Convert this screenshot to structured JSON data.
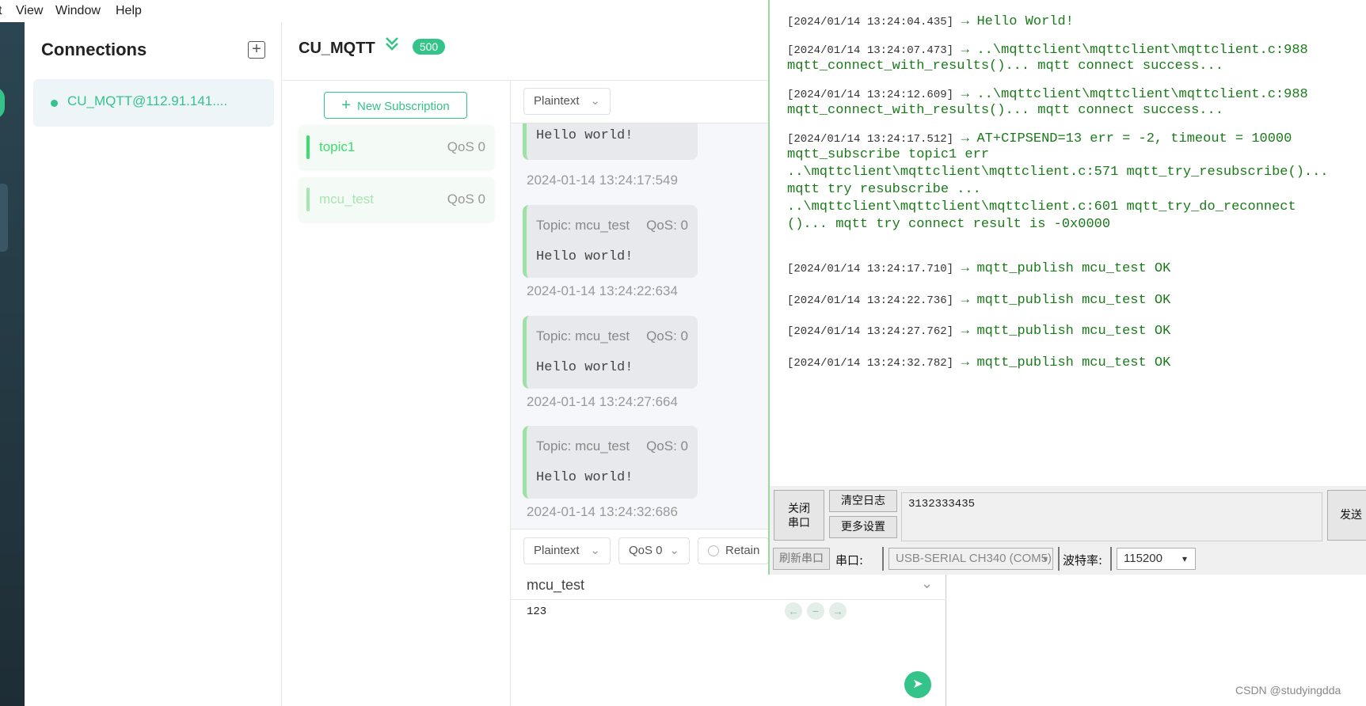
{
  "menubar": {
    "items": [
      "t",
      "View",
      "Window",
      "Help"
    ]
  },
  "connections": {
    "title": "Connections",
    "add_icon": "+",
    "items": [
      {
        "label": "CU_MQTT@112.91.141...."
      }
    ]
  },
  "topic_header": {
    "title": "CU_MQTT",
    "chevron": "⌄",
    "badge": "500"
  },
  "subscriptions": {
    "new_button": "New Subscription",
    "new_icon": "+",
    "items": [
      {
        "name": "topic1",
        "qos": "QoS 0",
        "color": "#3ddc6e"
      },
      {
        "name": "mcu_test",
        "qos": "QoS 0",
        "color": "#a8e6b0"
      }
    ]
  },
  "message_view": {
    "format": "Plaintext",
    "caret": "⌄",
    "messages": [
      {
        "payload": "Hello world!",
        "time": "2024-01-14 13:24:17:549"
      },
      {
        "topic": "Topic: mcu_test",
        "qos": "QoS: 0",
        "payload": "Hello world!",
        "time": "2024-01-14 13:24:22:634"
      },
      {
        "topic": "Topic: mcu_test",
        "qos": "QoS: 0",
        "payload": "Hello world!",
        "time": "2024-01-14 13:24:27:664"
      },
      {
        "topic": "Topic: mcu_test",
        "qos": "QoS: 0",
        "payload": "Hello world!",
        "time": "2024-01-14 13:24:32:686"
      }
    ]
  },
  "publish": {
    "format": "Plaintext",
    "qos": "QoS 0",
    "retain": "Retain",
    "topic": "mcu_test",
    "payload": "123",
    "icons": [
      "←",
      "−",
      "→"
    ],
    "send_icon": "➤"
  },
  "serial": {
    "log": [
      {
        "ts": "[2024/01/14 13:24:04.435]",
        "arrow": "→",
        "lines": [
          "Hello World!"
        ]
      },
      {
        "ts": "[2024/01/14 13:24:07.473]",
        "arrow": "→",
        "lines": [
          "..\\mqttclient\\mqttclient\\mqttclient.c:988",
          "mqtt_connect_with_results()... mqtt connect success..."
        ]
      },
      {
        "ts": "[2024/01/14 13:24:12.609]",
        "arrow": "→",
        "lines": [
          "..\\mqttclient\\mqttclient\\mqttclient.c:988",
          "mqtt_connect_with_results()... mqtt connect success..."
        ]
      },
      {
        "ts": "[2024/01/14 13:24:17.512]",
        "arrow": "→",
        "lines": [
          "AT+CIPSEND=13 err = -2, timeout = 10000",
          "mqtt_subscribe topic1 err",
          "..\\mqttclient\\mqttclient\\mqttclient.c:571 mqtt_try_resubscribe()...",
          "mqtt try resubscribe ...",
          "..\\mqttclient\\mqttclient\\mqttclient.c:601 mqtt_try_do_reconnect",
          "()... mqtt try connect result is -0x0000"
        ]
      },
      {
        "ts": "[2024/01/14 13:24:17.710]",
        "arrow": "→",
        "lines": [
          "mqtt_publish mcu_test OK"
        ]
      },
      {
        "ts": "[2024/01/14 13:24:22.736]",
        "arrow": "→",
        "lines": [
          "mqtt_publish mcu_test OK"
        ]
      },
      {
        "ts": "[2024/01/14 13:24:27.762]",
        "arrow": "→",
        "lines": [
          "mqtt_publish mcu_test OK"
        ]
      },
      {
        "ts": "[2024/01/14 13:24:32.782]",
        "arrow": "→",
        "lines": [
          "mqtt_publish mcu_test OK"
        ]
      }
    ],
    "close_port_line1": "关闭",
    "close_port_line2": "串口",
    "clear_log": "清空日志",
    "more_settings": "更多设置",
    "send_input": "3132333435",
    "send": "发送",
    "refresh_port": "刷新串口",
    "port_label": "串口:",
    "port_value": "USB-SERIAL CH340 (COM5)",
    "baud_label": "波特率:",
    "baud_value": "115200",
    "dropdown_arrow": "▾"
  },
  "watermark": "CSDN @studyingdda"
}
